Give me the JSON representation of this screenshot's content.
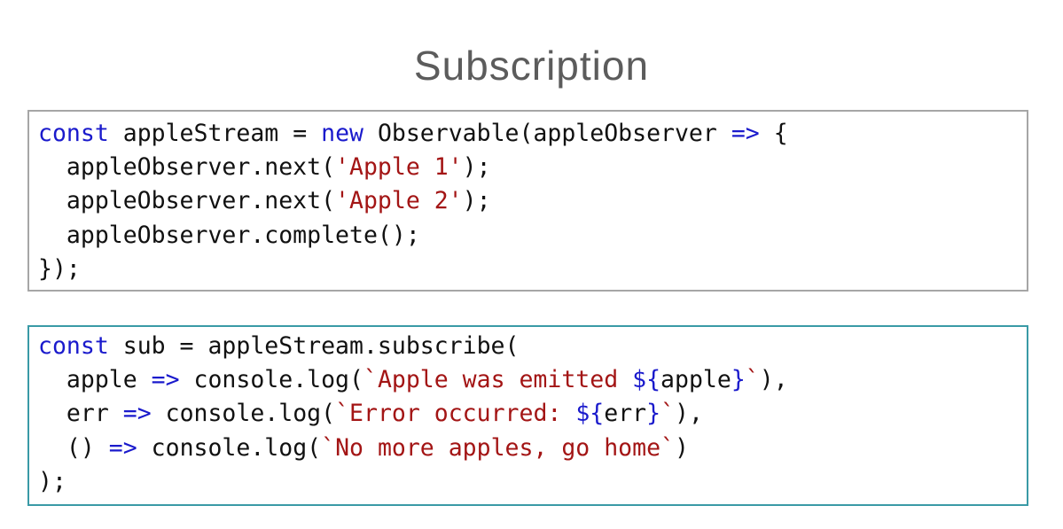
{
  "slide": {
    "title": "Subscription"
  },
  "code_block_1": {
    "lines": [
      [
        {
          "t": "const",
          "c": "kw"
        },
        {
          "t": " appleStream = ",
          "c": "plain"
        },
        {
          "t": "new",
          "c": "kw"
        },
        {
          "t": " Observable(appleObserver ",
          "c": "plain"
        },
        {
          "t": "=>",
          "c": "kw"
        },
        {
          "t": " {",
          "c": "plain"
        }
      ],
      [
        {
          "t": "  appleObserver.next(",
          "c": "plain"
        },
        {
          "t": "'Apple 1'",
          "c": "str"
        },
        {
          "t": ");",
          "c": "plain"
        }
      ],
      [
        {
          "t": "  appleObserver.next(",
          "c": "plain"
        },
        {
          "t": "'Apple 2'",
          "c": "str"
        },
        {
          "t": ");",
          "c": "plain"
        }
      ],
      [
        {
          "t": "  appleObserver.complete();",
          "c": "plain"
        }
      ],
      [
        {
          "t": "});",
          "c": "plain"
        }
      ]
    ]
  },
  "code_block_2": {
    "lines": [
      [
        {
          "t": "const",
          "c": "kw"
        },
        {
          "t": " sub = appleStream.subscribe(",
          "c": "plain"
        }
      ],
      [
        {
          "t": "  apple ",
          "c": "plain"
        },
        {
          "t": "=>",
          "c": "kw"
        },
        {
          "t": " console.log(",
          "c": "plain"
        },
        {
          "t": "`Apple was emitted ",
          "c": "str"
        },
        {
          "t": "${",
          "c": "kw"
        },
        {
          "t": "apple",
          "c": "plain"
        },
        {
          "t": "}",
          "c": "kw"
        },
        {
          "t": "`",
          "c": "str"
        },
        {
          "t": "),",
          "c": "plain"
        }
      ],
      [
        {
          "t": "  err ",
          "c": "plain"
        },
        {
          "t": "=>",
          "c": "kw"
        },
        {
          "t": " console.log(",
          "c": "plain"
        },
        {
          "t": "`Error occurred: ",
          "c": "str"
        },
        {
          "t": "${",
          "c": "kw"
        },
        {
          "t": "err",
          "c": "plain"
        },
        {
          "t": "}",
          "c": "kw"
        },
        {
          "t": "`",
          "c": "str"
        },
        {
          "t": "),",
          "c": "plain"
        }
      ],
      [
        {
          "t": "  () ",
          "c": "plain"
        },
        {
          "t": "=>",
          "c": "kw"
        },
        {
          "t": " console.log(",
          "c": "plain"
        },
        {
          "t": "`No more apples, go home`",
          "c": "str"
        },
        {
          "t": ")",
          "c": "plain"
        }
      ],
      [
        {
          "t": ");",
          "c": "plain"
        }
      ]
    ]
  }
}
